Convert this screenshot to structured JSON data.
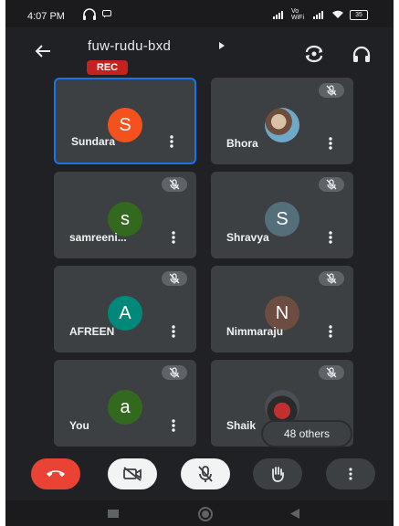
{
  "status_bar": {
    "time": "4:07 PM",
    "network_label": "Vo WiFi",
    "battery": "35"
  },
  "meeting": {
    "code": "fuw-rudu-bxd",
    "rec_label": "REC"
  },
  "participants": [
    {
      "name": "Sundara",
      "initial": "S",
      "avatar_color": "#f4511e",
      "active": true,
      "muted": false,
      "has_photo": false
    },
    {
      "name": "Bhora",
      "initial": "",
      "avatar_color": "",
      "active": false,
      "muted": true,
      "has_photo": true
    },
    {
      "name": "samreeni...",
      "initial": "s",
      "avatar_color": "#33691e",
      "active": false,
      "muted": true,
      "has_photo": false
    },
    {
      "name": "Shravya",
      "initial": "S",
      "avatar_color": "#546e7a",
      "active": false,
      "muted": true,
      "has_photo": false
    },
    {
      "name": "AFREEN",
      "initial": "A",
      "avatar_color": "#00897b",
      "active": false,
      "muted": true,
      "has_photo": false
    },
    {
      "name": "Nimmaraju",
      "initial": "N",
      "avatar_color": "#6d4c41",
      "active": false,
      "muted": true,
      "has_photo": false
    },
    {
      "name": "You",
      "initial": "a",
      "avatar_color": "#33691e",
      "active": false,
      "muted": true,
      "has_photo": false
    },
    {
      "name": "Shaik",
      "initial": "",
      "avatar_color": "",
      "active": false,
      "muted": true,
      "has_photo": true
    }
  ],
  "others_label": "48 others",
  "colors": {
    "background": "#202124",
    "tile": "#3c4043",
    "active_border": "#1a73e8",
    "end_call": "#ea4335"
  }
}
